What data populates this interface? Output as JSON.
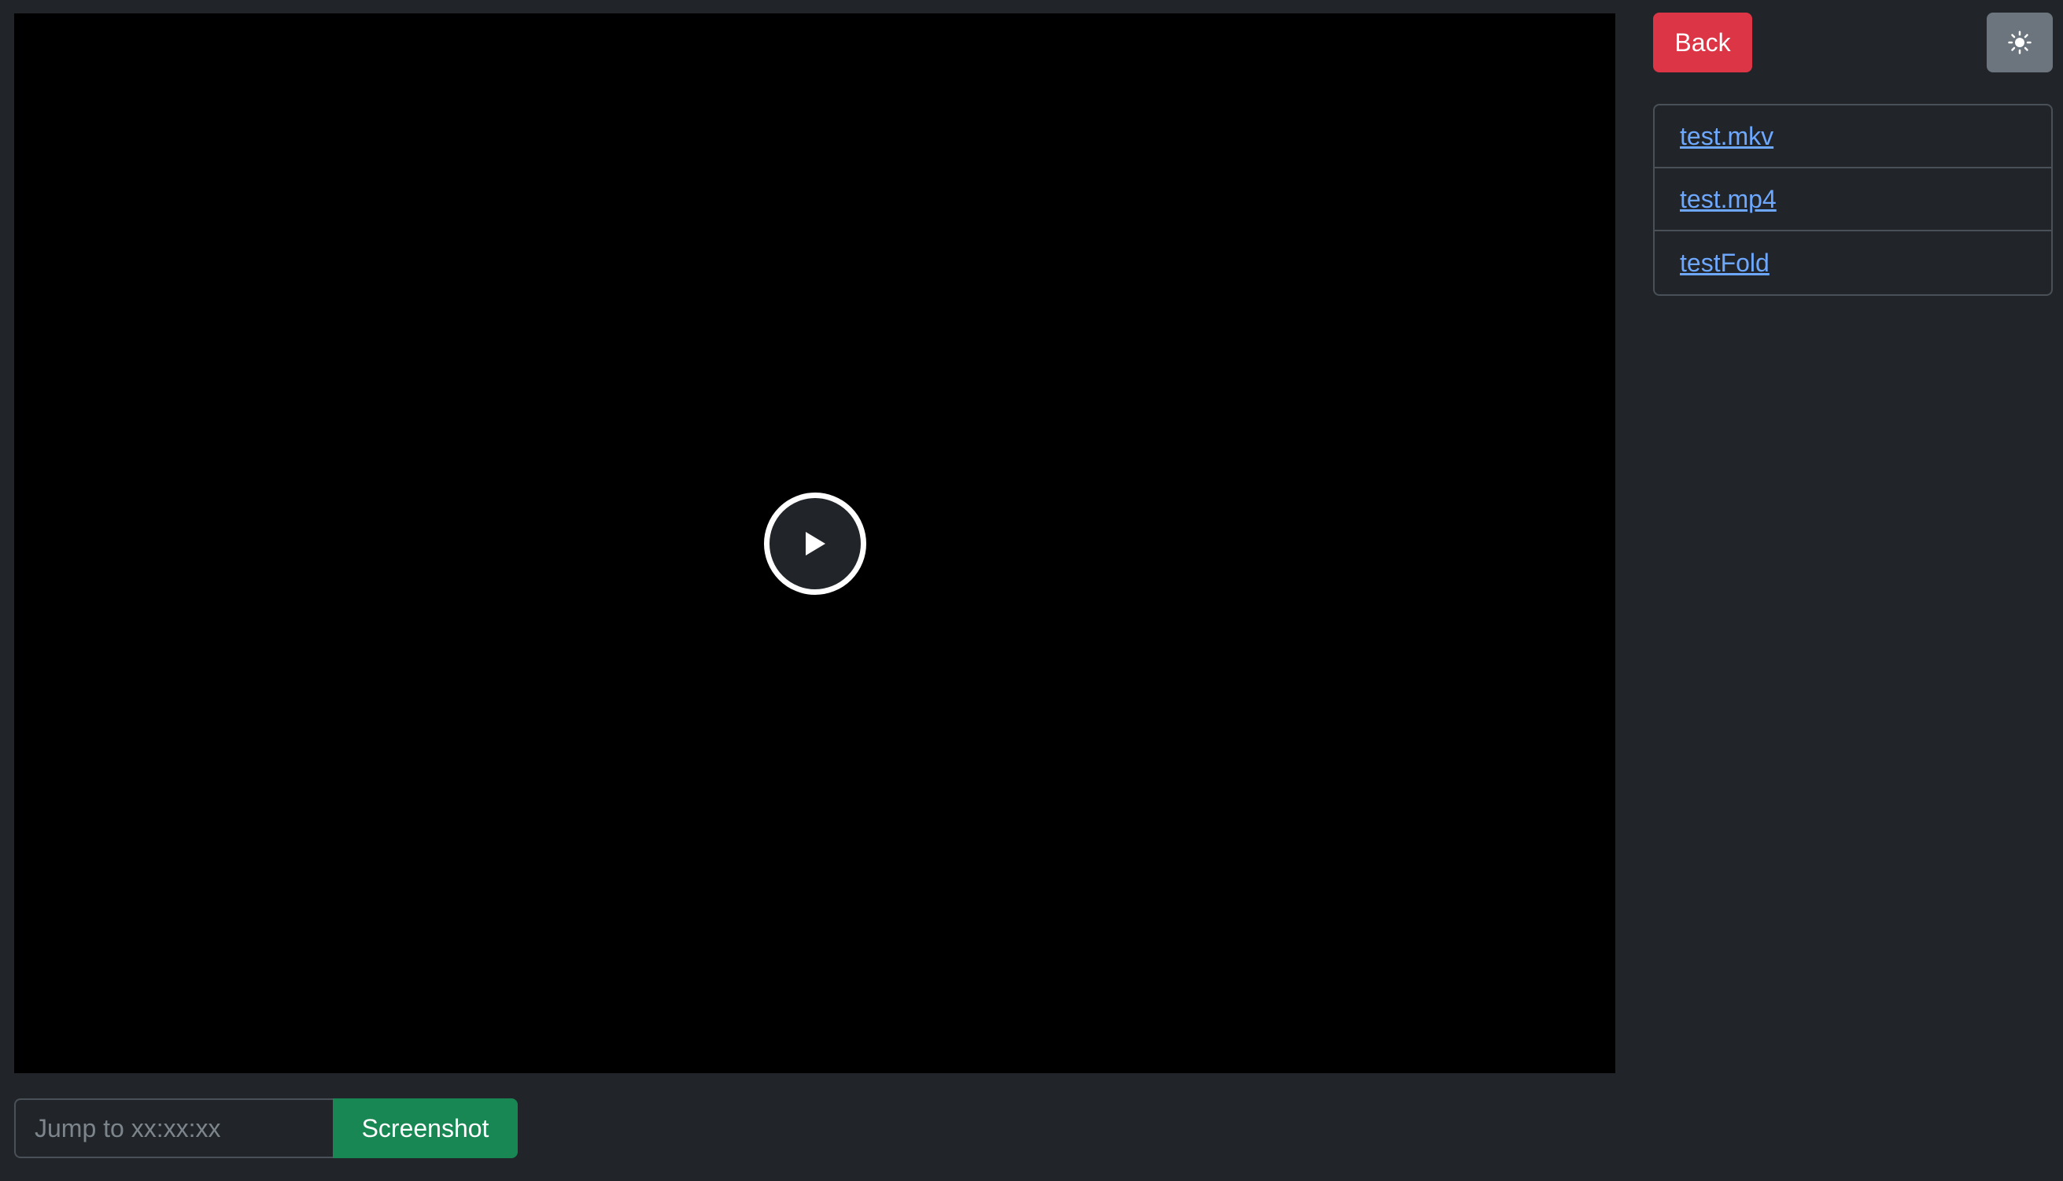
{
  "player": {
    "play_icon": "play-icon"
  },
  "controls": {
    "jump_placeholder": "Jump to xx:xx:xx",
    "jump_value": "",
    "screenshot_label": "Screenshot"
  },
  "header": {
    "back_label": "Back",
    "theme_icon": "sun-icon"
  },
  "files": [
    {
      "name": "test.mkv"
    },
    {
      "name": "test.mp4"
    },
    {
      "name": "testFold"
    }
  ],
  "colors": {
    "background": "#212529",
    "video": "#000000",
    "back_button": "#dc3545",
    "screenshot_button": "#198754",
    "theme_button": "#6c757d",
    "link": "#6ea8fe"
  }
}
